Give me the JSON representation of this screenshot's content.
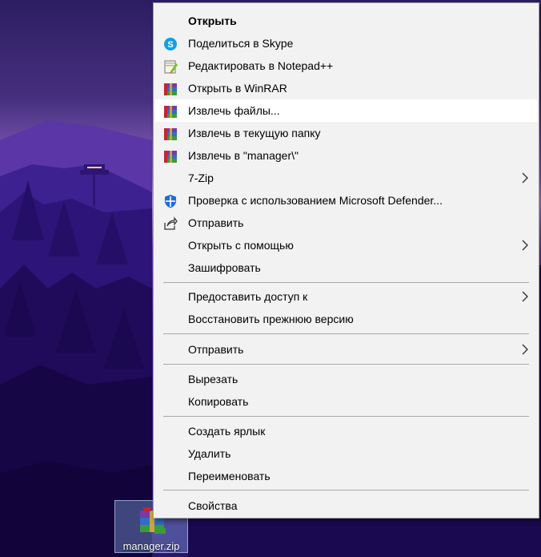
{
  "desktop": {
    "file": {
      "name": "manager.zip",
      "icon": "winrar-archive-icon"
    }
  },
  "context_menu": {
    "items": [
      {
        "label": "Открыть",
        "bold": true,
        "icon": ""
      },
      {
        "label": "Поделиться в Skype",
        "icon": "skype-icon"
      },
      {
        "label": "Редактировать в Notepad++",
        "icon": "notepad-plus-plus-icon"
      },
      {
        "label": "Открыть в WinRAR",
        "icon": "winrar-icon"
      },
      {
        "label": "Извлечь файлы...",
        "icon": "winrar-icon",
        "highlighted": true
      },
      {
        "label": "Извлечь в текущую папку",
        "icon": "winrar-icon"
      },
      {
        "label": "Извлечь в \"manager\\\"",
        "icon": "winrar-icon"
      },
      {
        "label": "7-Zip",
        "icon": "",
        "submenu": true
      },
      {
        "label": "Проверка с использованием Microsoft Defender...",
        "icon": "defender-shield-icon"
      },
      {
        "label": "Отправить",
        "icon": "share-icon"
      },
      {
        "label": "Открыть с помощью",
        "icon": "",
        "submenu": true
      },
      {
        "label": "Зашифровать",
        "icon": ""
      },
      {
        "label": "Предоставить доступ к",
        "icon": "",
        "submenu": true
      },
      {
        "label": "Восстановить прежнюю версию",
        "icon": ""
      },
      {
        "label": "Отправить",
        "icon": "",
        "submenu": true
      },
      {
        "label": "Вырезать",
        "icon": ""
      },
      {
        "label": "Копировать",
        "icon": ""
      },
      {
        "label": "Создать ярлык",
        "icon": ""
      },
      {
        "label": "Удалить",
        "icon": ""
      },
      {
        "label": "Переименовать",
        "icon": ""
      },
      {
        "label": "Свойства",
        "icon": ""
      }
    ]
  },
  "colors": {
    "menu_background": "#f2f2f2",
    "highlight": "#ffffff",
    "skype": "#0fa0e8",
    "defender": "#1d6fd6"
  }
}
